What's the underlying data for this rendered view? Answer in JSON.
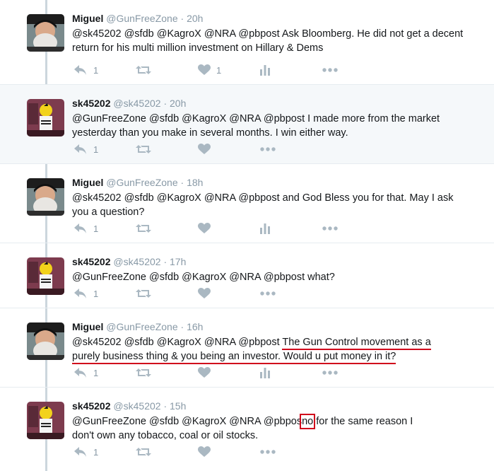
{
  "tweets": [
    {
      "name": "Miguel",
      "handle": "@GunFreeZone",
      "time": "20h",
      "text_plain": "@sk45202 @sfdb @KagroX @NRA @pbpost Ask Bloomberg. He did not get a decent return for his multi million investment on Hillary & Dems",
      "reply_count": "1",
      "like_count": "1",
      "show_analytics": true,
      "highlighted": false
    },
    {
      "name": "sk45202",
      "handle": "@sk45202",
      "time": "20h",
      "text_plain": "@GunFreeZone @sfdb @KagroX @NRA @pbpost I made more from the market yesterday than you make in several months. I win either way.",
      "reply_count": "1",
      "like_count": "",
      "show_analytics": false,
      "highlighted": true
    },
    {
      "name": "Miguel",
      "handle": "@GunFreeZone",
      "time": "18h",
      "text_plain": "@sk45202 @sfdb @KagroX @NRA @pbpost and God Bless you for that. May I ask you a question?",
      "reply_count": "1",
      "like_count": "",
      "show_analytics": true,
      "highlighted": false
    },
    {
      "name": "sk45202",
      "handle": "@sk45202",
      "time": "17h",
      "text_plain": "@GunFreeZone @sfdb @KagroX @NRA @pbpost what?",
      "reply_count": "1",
      "like_count": "",
      "show_analytics": false,
      "highlighted": false
    },
    {
      "name": "Miguel",
      "handle": "@GunFreeZone",
      "time": "16h",
      "text_prefix": "@sk45202 @sfdb @KagroX @NRA @pbpost ",
      "text_underlined_1": "The Gun Control movement as a",
      "text_underlined_2": "purely business thing & you being an investor. Would u put money in it?",
      "reply_count": "1",
      "like_count": "",
      "show_analytics": true,
      "highlighted": false
    },
    {
      "name": "sk45202",
      "handle": "@sk45202",
      "time": "15h",
      "text_prefix": "@GunFreeZone @sfdb @KagroX @NRA @pbpos",
      "text_boxed": "no",
      "text_suffix_1": " for the same reason I",
      "text_suffix_2": "don't own any tobacco, coal or oil stocks.",
      "reply_count": "1",
      "like_count": "",
      "show_analytics": false,
      "highlighted": false
    }
  ],
  "separator": "·",
  "colors": {
    "annotation_red": "#d0021b",
    "icon_gray": "#aab8c2",
    "meta_gray": "#8899a6",
    "highlight_bg": "#f5f8fa"
  },
  "icons": {
    "reply": "reply-icon",
    "retweet": "retweet-icon",
    "like": "heart-icon",
    "analytics": "analytics-icon",
    "more": "more-icon"
  }
}
